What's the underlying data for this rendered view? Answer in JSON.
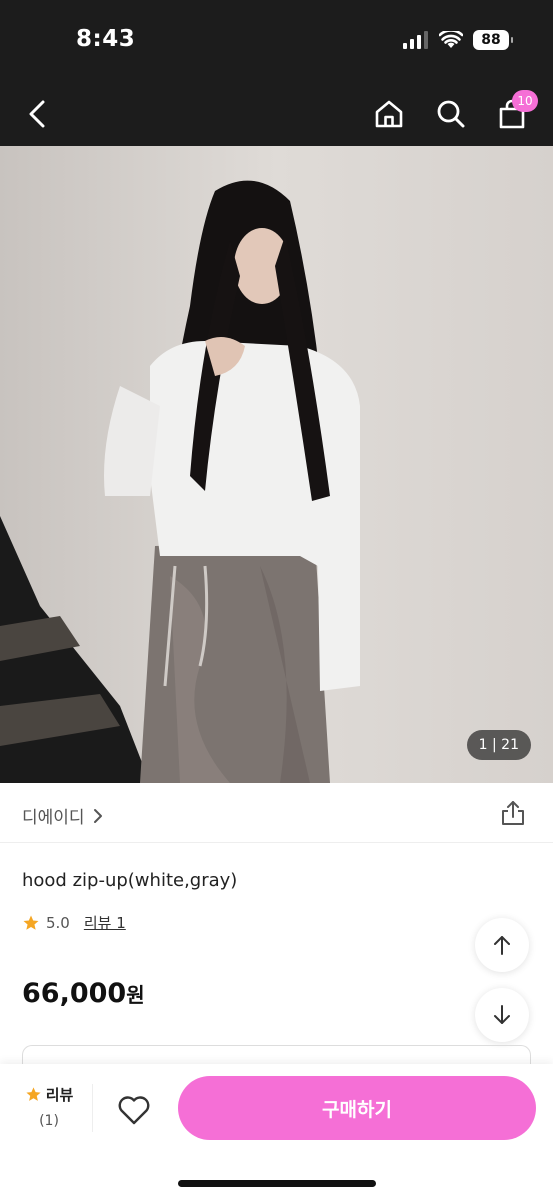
{
  "status_bar": {
    "time": "8:43",
    "battery": "88"
  },
  "nav": {
    "cart_count": "10"
  },
  "gallery": {
    "counter": "1 | 21"
  },
  "store": {
    "name": "디에이디"
  },
  "product": {
    "title": "hood zip-up(white,gray)",
    "rating": "5.0",
    "review_link": "리뷰 1",
    "price": "66,000",
    "currency": "원"
  },
  "bottom_bar": {
    "review_label": "리뷰",
    "review_count": "(1)",
    "buy_label": "구매하기"
  },
  "colors": {
    "accent": "#f56fd6",
    "star": "#f5a623",
    "header_bg": "#1c1c1c"
  }
}
